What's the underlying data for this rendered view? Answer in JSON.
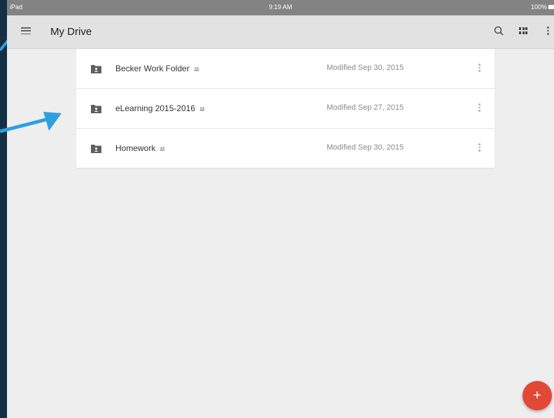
{
  "status_bar": {
    "carrier": "iPad",
    "time": "9:19 AM",
    "battery": "100%"
  },
  "toolbar": {
    "title": "My Drive",
    "menu_icon": "hamburger-menu-icon",
    "search_icon": "search-icon",
    "grid_icon": "grid-view-icon",
    "more_icon": "more-vert-icon"
  },
  "files": [
    {
      "name": "Becker Work Folder",
      "modified": "Modified Sep 30, 2015",
      "shared": true
    },
    {
      "name": "eLearning 2015-2016",
      "modified": "Modified Sep 27, 2015",
      "shared": true
    },
    {
      "name": "Homework",
      "modified": "Modified Sep 30, 2015",
      "shared": true
    }
  ],
  "fab": {
    "label": "+"
  },
  "colors": {
    "background": "#eeeeee",
    "toolbar": "#e2e2e2",
    "status_bar": "#838383",
    "fab": "#e24836",
    "annotation_arrow": "#2f9fe0",
    "outer_background": "#152f45"
  }
}
